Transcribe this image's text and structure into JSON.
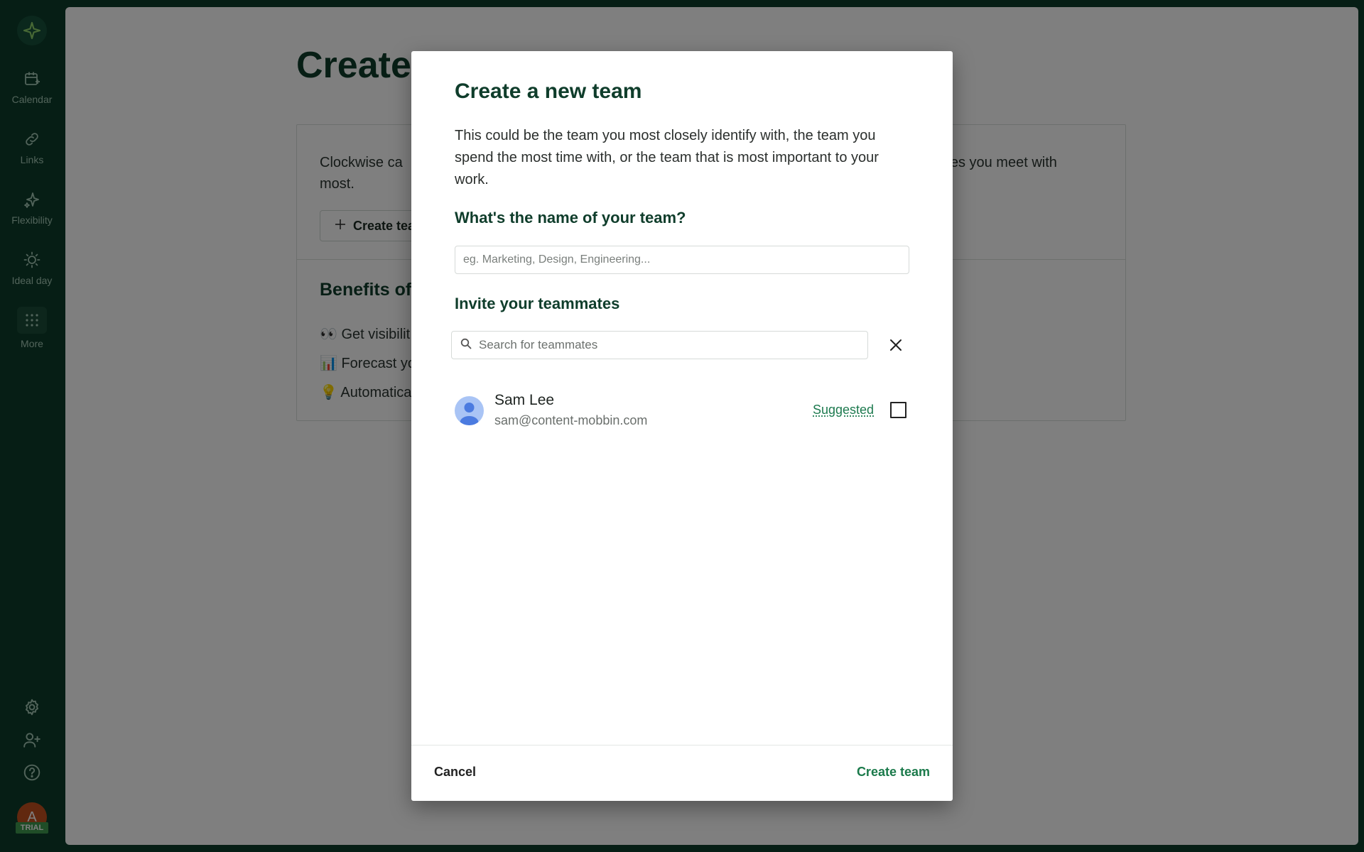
{
  "sidebar": {
    "items": [
      {
        "label": "Calendar",
        "icon": "calendar-icon"
      },
      {
        "label": "Links",
        "icon": "link-icon"
      },
      {
        "label": "Flexibility",
        "icon": "sparkle-icon"
      },
      {
        "label": "Ideal day",
        "icon": "sun-icon"
      },
      {
        "label": "More",
        "icon": "grid-dots-icon"
      }
    ],
    "bottom_icons": [
      "settings-icon",
      "add-user-icon",
      "help-icon"
    ],
    "user_initial": "A",
    "trial_badge": "TRIAL"
  },
  "background_page": {
    "title": "Create",
    "card_description": "Clockwise ca                                                                                                               es you meet with most.",
    "card_description_left": "Clockwise ca",
    "card_description_left2": "most.",
    "card_description_right": "es you meet with",
    "create_button_label": "Create tea",
    "benefits_title": "Benefits of",
    "benefits": [
      "👀 Get visibilit",
      "📊 Forecast yo",
      "💡 Automatica"
    ]
  },
  "modal": {
    "title": "Create a new team",
    "description": "This could be the team you most closely identify with, the team you spend the most time with, or the team that is most important to your work.",
    "name_question": "What's the name of your team?",
    "name_placeholder": "eg. Marketing, Design, Engineering...",
    "name_value": "",
    "invite_label": "Invite your teammates",
    "search_placeholder": "Search for teammates",
    "teammates": [
      {
        "name": "Sam Lee",
        "email": "sam@content-mobbin.com",
        "tag": "Suggested",
        "checked": false
      }
    ],
    "cancel_label": "Cancel",
    "create_label": "Create team"
  },
  "colors": {
    "brand_dark_green": "#0d3d2a",
    "accent_green": "#1b7a4b",
    "overlay": "rgba(0,0,0,0.5)"
  }
}
